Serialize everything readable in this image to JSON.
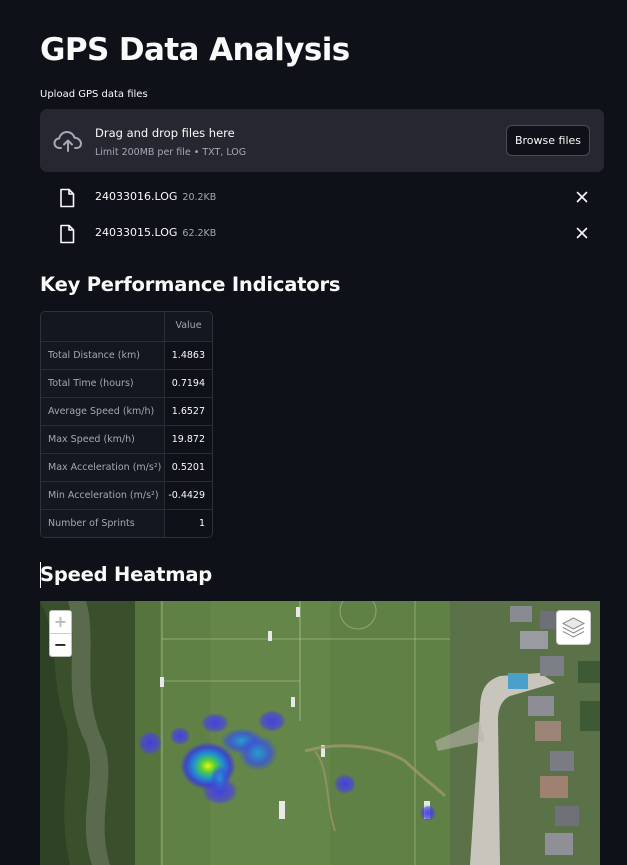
{
  "page": {
    "title": "GPS Data Analysis"
  },
  "uploader": {
    "label": "Upload GPS data files",
    "drop_text": "Drag and drop files here",
    "limit_text": "Limit 200MB per file • TXT, LOG",
    "browse_label": "Browse files",
    "cloud_icon": "cloud-upload-icon",
    "files": [
      {
        "name": "24033016.LOG",
        "size": "20.2KB",
        "icon": "file-icon",
        "remove_icon": "close-icon"
      },
      {
        "name": "24033015.LOG",
        "size": "62.2KB",
        "icon": "file-icon",
        "remove_icon": "close-icon"
      }
    ]
  },
  "kpi": {
    "heading": "Key Performance Indicators",
    "column_header": "Value",
    "rows": [
      {
        "label": "Total Distance (km)",
        "value": "1.4863"
      },
      {
        "label": "Total Time (hours)",
        "value": "0.7194"
      },
      {
        "label": "Average Speed (km/h)",
        "value": "1.6527"
      },
      {
        "label": "Max Speed (km/h)",
        "value": "19.872"
      },
      {
        "label": "Max Acceleration (m/s²)",
        "value": "0.5201"
      },
      {
        "label": "Min Acceleration (m/s²)",
        "value": "-0.4429"
      },
      {
        "label": "Number of Sprints",
        "value": "1"
      }
    ]
  },
  "heatmap": {
    "heading": "Speed Heatmap",
    "zoom_in_label": "+",
    "zoom_out_label": "−",
    "layers_icon": "layers-icon"
  },
  "colors": {
    "background": "#0e1117",
    "surface": "#262730",
    "text": "#fafafa",
    "muted_text": "#a3a8b8"
  }
}
